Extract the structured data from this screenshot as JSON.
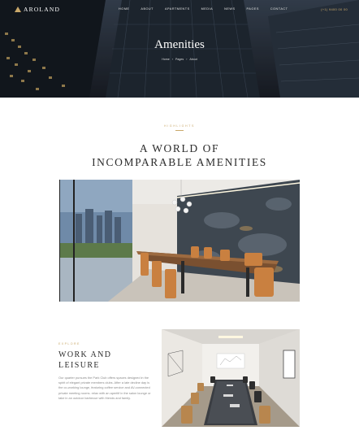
{
  "header": {
    "logo_text": "AROLAND",
    "nav": [
      "HOME",
      "ABOUT",
      "APARTMENTS",
      "MEDIA",
      "NEWS",
      "PAGES",
      "CONTACT"
    ],
    "phone": "(+1) 9400 00 00"
  },
  "hero": {
    "title": "Amenities",
    "breadcrumb": [
      "Home",
      "Pages",
      "About"
    ]
  },
  "intro": {
    "kicker": "HIGHLIGHTS",
    "heading_line1": "A WORLD OF",
    "heading_line2": "INCOMPARABLE AMENITIES"
  },
  "feature": {
    "kicker": "EXPLORE",
    "heading_line1": "WORK AND",
    "heading_line2": "LEISURE",
    "body": "Our quarter pursues the Park Club offers spaces designed in the spirit of elegant private members clubs. After a late decline day is the co-working lounge, featuring coffee service and AV-connected private meeting rooms. relax with an aperitif in the salon lounge or take in an outdoor barbecue with friends and family."
  },
  "colors": {
    "accent": "#c9a86a",
    "heading": "#2c2c2c",
    "body_text": "#8a8a8a"
  }
}
